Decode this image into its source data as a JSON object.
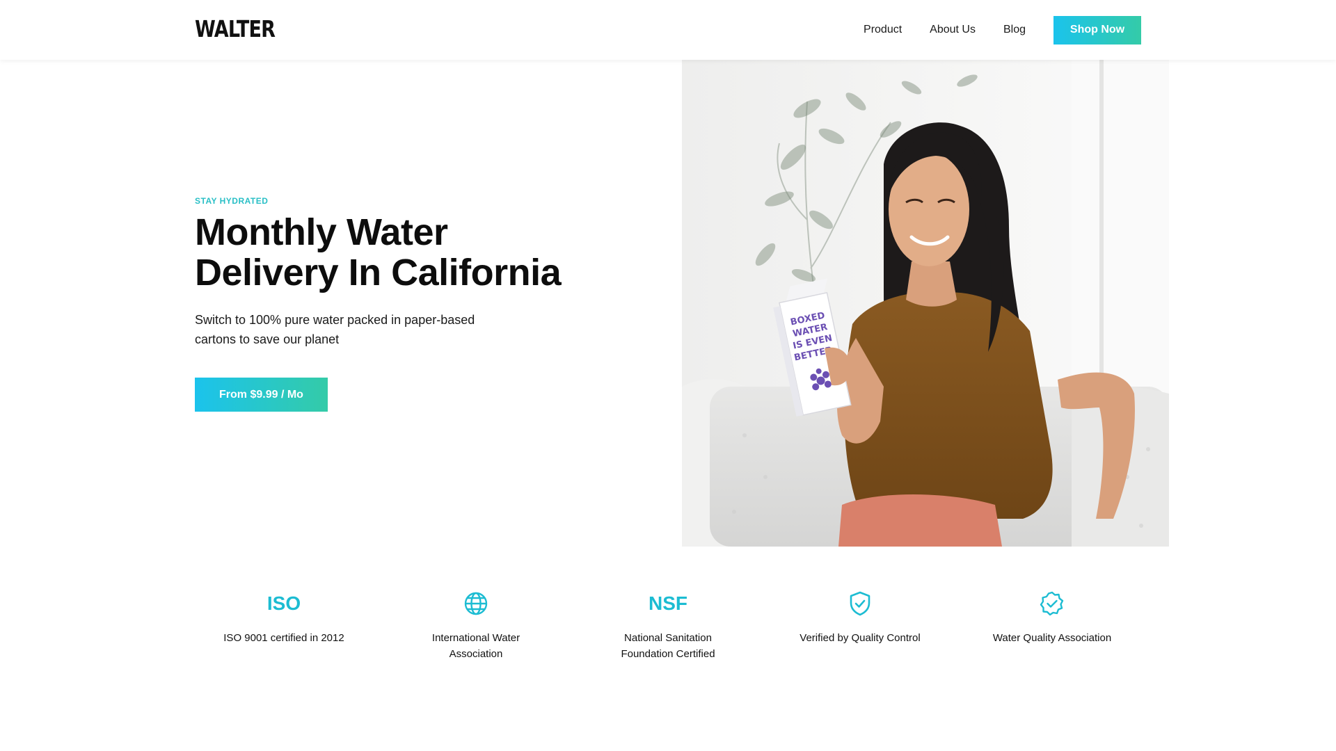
{
  "brand": {
    "logo": "WALTER",
    "accent_gradient": [
      "#1bc3ec",
      "#34cba8"
    ],
    "eyebrow_color": "#29bfc6",
    "icon_color": "#1cbcd2"
  },
  "nav": {
    "links": [
      "Product",
      "About Us",
      "Blog"
    ],
    "cta": "Shop Now"
  },
  "hero": {
    "eyebrow": "STAY HYDRATED",
    "title": "Monthly Water Delivery In California",
    "subtitle": "Switch to 100% pure water packed in paper-based cartons to save our planet",
    "cta": "From $9.99 / Mo",
    "image": {
      "subject": "woman-holding-water-carton",
      "carton_text": "BOXED WATER IS EVEN BETTER."
    }
  },
  "features": [
    {
      "mark": "ISO",
      "icon": null,
      "label": "ISO 9001 certified in 2012"
    },
    {
      "mark": null,
      "icon": "globe-icon",
      "label": "International Water Association"
    },
    {
      "mark": "NSF",
      "icon": null,
      "label": "National Sanitation Foundation Certified"
    },
    {
      "mark": null,
      "icon": "shield-check-icon",
      "label": "Verified by Quality Control"
    },
    {
      "mark": null,
      "icon": "badge-check-icon",
      "label": "Water Quality Association"
    }
  ]
}
